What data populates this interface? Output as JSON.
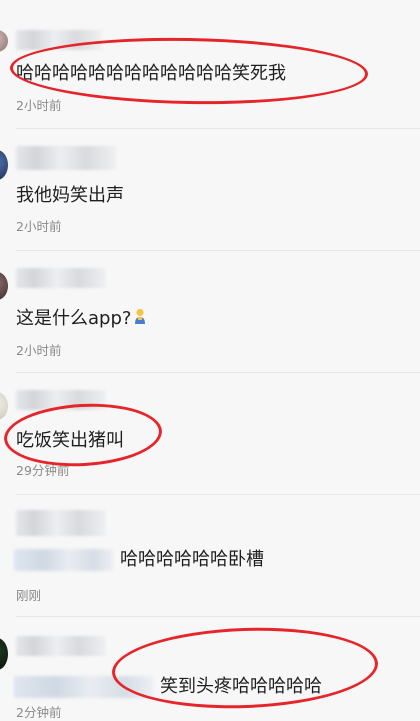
{
  "comments": [
    {
      "text": "哈哈哈哈哈哈哈哈哈哈哈哈笑死我",
      "time": "2小时前"
    },
    {
      "text": "我他妈笑出声",
      "time": "2小时前"
    },
    {
      "text": "这是什么app?",
      "time": "2小时前",
      "icon": "person-emoji-icon"
    },
    {
      "text": "吃饭笑出猪叫",
      "time": "29分钟前"
    },
    {
      "text": "哈哈哈哈哈哈卧槽",
      "time": "刚刚"
    },
    {
      "text": "笑到头疼哈哈哈哈哈",
      "time": "2分钟前"
    }
  ],
  "colors": {
    "highlight": "#e5252a",
    "text": "#1f1f1f",
    "time": "#8a8a8a"
  }
}
